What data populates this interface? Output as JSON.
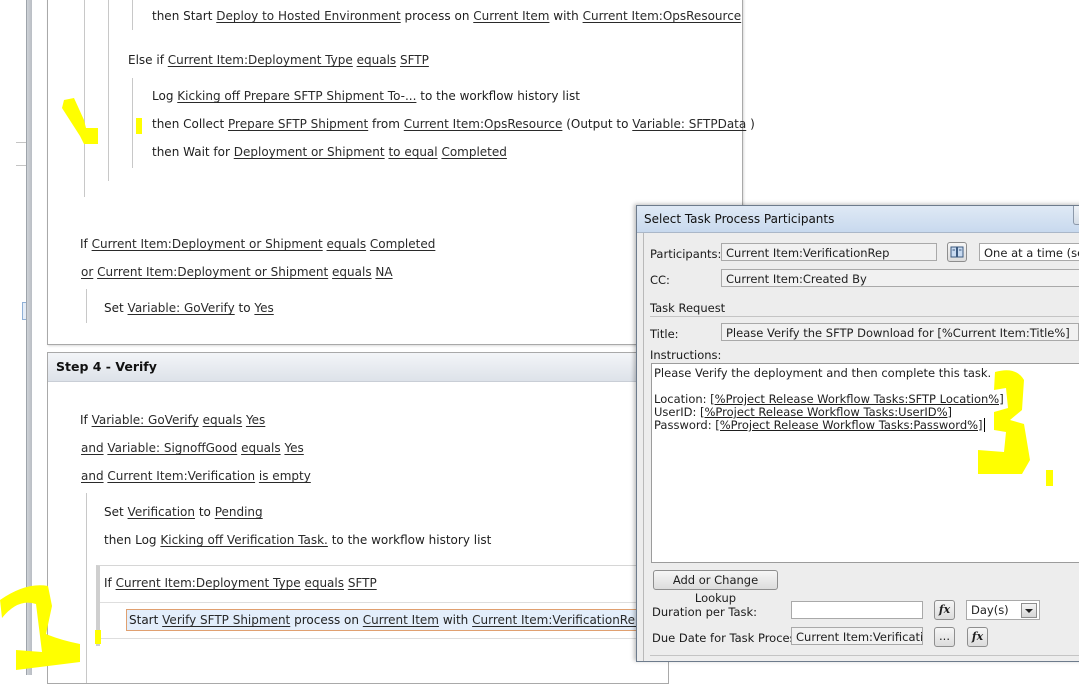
{
  "workflow": {
    "step3": {
      "lines": {
        "start_deploy": {
          "prefix": "then Start",
          "process": "Deploy to Hosted Environment",
          "mid1": "process on",
          "item": "Current Item",
          "mid2": "with",
          "param": "Current Item:OpsResource"
        },
        "else_if": {
          "prefix": "Else if",
          "field": "Current Item:Deployment Type",
          "op": "equals",
          "value": "SFTP"
        },
        "log": {
          "prefix": "Log",
          "message": "Kicking off Prepare SFTP Shipment To-...",
          "suffix": "to the workflow history list"
        },
        "collect": {
          "prefix": "then Collect",
          "task": "Prepare SFTP Shipment",
          "mid": "from",
          "source": "Current Item:OpsResource",
          "output_prefix": "(Output to",
          "output": "Variable: SFTPData",
          "output_suffix": ")"
        },
        "wait": {
          "prefix": "then Wait for",
          "field": "Deployment or Shipment",
          "op": "to equal",
          "value": "Completed"
        },
        "if_completed": {
          "prefix": "If",
          "field": "Current Item:Deployment or Shipment",
          "op": "equals",
          "value": "Completed"
        },
        "or_na": {
          "conj": "or",
          "field": "Current Item:Deployment or Shipment",
          "op": "equals",
          "value": "NA"
        },
        "set_goverify": {
          "prefix": "Set",
          "variable": "Variable: GoVerify",
          "mid": "to",
          "value": "Yes"
        }
      }
    },
    "step4": {
      "title": "Step 4 - Verify",
      "lines": {
        "if_goverify": {
          "prefix": "If",
          "field": "Variable: GoVerify",
          "op": "equals",
          "value": "Yes"
        },
        "and_signoff": {
          "conj": "and",
          "field": "Variable: SignoffGood",
          "op": "equals",
          "value": "Yes"
        },
        "and_verification": {
          "conj": "and",
          "field": "Current Item:Verification",
          "op": "is empty"
        },
        "set_verification": {
          "prefix": "Set",
          "field": "Verification",
          "mid": "to",
          "value": "Pending"
        },
        "log_verification": {
          "prefix": "then Log",
          "message": "Kicking off Verification Task.",
          "suffix": "to the workflow history list"
        },
        "if_sftp": {
          "prefix": "If",
          "field": "Current Item:Deployment Type",
          "op": "equals",
          "value": "SFTP"
        },
        "start_verify": {
          "prefix": "Start",
          "process": "Verify SFTP Shipment",
          "mid1": "process on",
          "item": "Current Item",
          "mid2": "with",
          "param": "Current Item:VerificationRep"
        }
      }
    }
  },
  "dialog": {
    "title": "Select Task Process Participants",
    "participants_label": "Participants:",
    "participants_value": "Current Item:VerificationRep",
    "address_book_icon": "address-book-icon",
    "order_value": "One at a time (serial)",
    "cc_label": "CC:",
    "cc_value": "Current Item:Created By",
    "task_request_label": "Task Request",
    "title_label": "Title:",
    "title_value": "Please Verify the SFTP Download for [%Current Item:Title%]",
    "instructions_label": "Instructions:",
    "instructions": {
      "line1": "Please Verify the deployment and then complete this task.",
      "location_label": "Location:",
      "location_value": "[%Project Release Workflow Tasks:SFTP Location%]",
      "userid_label": "UserID:",
      "userid_value": "[%Project Release Workflow Tasks:UserID%]",
      "password_label": "Password:",
      "password_value": "[%Project Release Workflow Tasks:Password%]"
    },
    "lookup_button": "Add or Change Lookup",
    "duration_label": "Duration per Task:",
    "duration_value": "",
    "fx_label": "fx",
    "duration_unit": "Day(s)",
    "due_date_label": "Due Date for Task Process:",
    "due_date_value": "Current Item:VerificationDue",
    "ellipsis_label": "..."
  },
  "annotations": {
    "mark1": "1.",
    "mark2": "2.",
    "mark3": "3.",
    "color": "#ffff00"
  }
}
